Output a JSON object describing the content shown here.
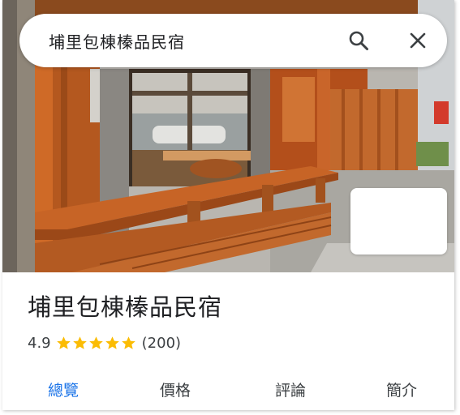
{
  "search": {
    "query": "埔里包棟榛品民宿",
    "search_icon": "search-icon",
    "close_icon": "close-icon"
  },
  "place": {
    "name": "埔里包棟榛品民宿",
    "rating": "4.9",
    "stars": 5,
    "review_count": "(200)"
  },
  "tabs": [
    {
      "label": "總覽",
      "active": true
    },
    {
      "label": "價格",
      "active": false
    },
    {
      "label": "評論",
      "active": false
    },
    {
      "label": "簡介",
      "active": false
    }
  ],
  "colors": {
    "accent": "#1a73e8",
    "star": "#fbbc04",
    "text": "#202124",
    "wood": "#c2692d"
  }
}
